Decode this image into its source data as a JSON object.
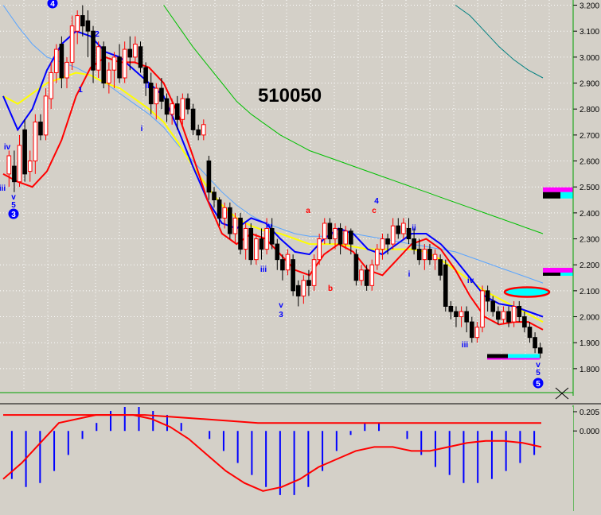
{
  "title": "510050",
  "colors": {
    "background": "#d4d0c8",
    "grid": "#ffffff",
    "candle_up": "#ff0000",
    "candle_down": "#000000",
    "ma_short": "#ff0000",
    "band_upper": "#0000ff",
    "ma_mid": "#ffff00",
    "band_outer": "#5aa5ff",
    "ma_long": "#00c000",
    "ma_longest": "#008080",
    "wave_label_blue": "#0000ff",
    "wave_label_red": "#ff0000",
    "axis_line": "#00a000"
  },
  "cursor_icon": "crosshair-icon",
  "chart_data": [
    {
      "type": "candlestick",
      "title": "510050",
      "ylim": [
        1.72,
        3.22
      ],
      "yticks": [
        "3.200",
        "3.100",
        "3.000",
        "2.900",
        "2.800",
        "2.700",
        "2.600",
        "2.500",
        "2.400",
        "2.300",
        "2.200",
        "2.100",
        "2.000",
        "1.900",
        "1.800"
      ],
      "grid": true,
      "candles": [
        [
          2.55,
          2.62,
          2.5,
          2.64
        ],
        [
          2.58,
          2.52,
          2.48,
          2.64
        ],
        [
          2.52,
          2.66,
          2.5,
          2.7
        ],
        [
          2.72,
          2.55,
          2.52,
          2.76
        ],
        [
          2.56,
          2.6,
          2.52,
          2.64
        ],
        [
          2.6,
          2.75,
          2.55,
          2.78
        ],
        [
          2.75,
          2.7,
          2.68,
          2.78
        ],
        [
          2.7,
          2.85,
          2.68,
          2.88
        ],
        [
          2.84,
          2.94,
          2.8,
          2.98
        ],
        [
          2.94,
          3.03,
          2.9,
          3.05
        ],
        [
          3.05,
          2.92,
          2.88,
          3.08
        ],
        [
          2.92,
          2.98,
          2.88,
          3.0
        ],
        [
          2.98,
          3.12,
          2.95,
          3.16
        ],
        [
          3.1,
          3.16,
          3.05,
          3.18
        ],
        [
          3.16,
          3.12,
          3.08,
          3.2
        ],
        [
          3.14,
          3.1,
          3.0,
          3.18
        ],
        [
          3.1,
          2.95,
          2.9,
          3.12
        ],
        [
          2.95,
          3.04,
          2.92,
          3.06
        ],
        [
          3.04,
          2.9,
          2.88,
          3.06
        ],
        [
          2.9,
          2.95,
          2.86,
          2.98
        ],
        [
          2.95,
          3.0,
          2.88,
          3.02
        ],
        [
          3.0,
          2.92,
          2.9,
          3.05
        ],
        [
          2.92,
          3.03,
          2.9,
          3.06
        ],
        [
          3.03,
          3.0,
          2.95,
          3.08
        ],
        [
          3.0,
          3.05,
          2.98,
          3.08
        ],
        [
          3.04,
          2.96,
          2.94,
          3.06
        ],
        [
          2.96,
          2.9,
          2.85,
          2.98
        ],
        [
          2.9,
          2.82,
          2.78,
          2.94
        ],
        [
          2.82,
          2.88,
          2.76,
          2.9
        ],
        [
          2.88,
          2.83,
          2.8,
          2.92
        ],
        [
          2.84,
          2.78,
          2.75,
          2.86
        ],
        [
          2.78,
          2.82,
          2.74,
          2.84
        ],
        [
          2.82,
          2.76,
          2.72,
          2.85
        ],
        [
          2.76,
          2.84,
          2.74,
          2.86
        ],
        [
          2.84,
          2.8,
          2.78,
          2.86
        ],
        [
          2.8,
          2.72,
          2.7,
          2.82
        ],
        [
          2.72,
          2.7,
          2.68,
          2.74
        ],
        [
          2.7,
          2.74,
          2.68,
          2.76
        ],
        [
          2.6,
          2.48,
          2.45,
          2.62
        ],
        [
          2.48,
          2.45,
          2.42,
          2.5
        ],
        [
          2.45,
          2.38,
          2.35,
          2.46
        ],
        [
          2.38,
          2.42,
          2.34,
          2.44
        ],
        [
          2.42,
          2.32,
          2.3,
          2.44
        ],
        [
          2.32,
          2.38,
          2.28,
          2.4
        ],
        [
          2.38,
          2.26,
          2.24,
          2.4
        ],
        [
          2.26,
          2.34,
          2.22,
          2.36
        ],
        [
          2.34,
          2.22,
          2.2,
          2.36
        ],
        [
          2.22,
          2.3,
          2.2,
          2.32
        ],
        [
          2.3,
          2.26,
          2.22,
          2.34
        ],
        [
          2.26,
          2.34,
          2.24,
          2.38
        ],
        [
          2.34,
          2.28,
          2.26,
          2.38
        ],
        [
          2.28,
          2.22,
          2.18,
          2.3
        ],
        [
          2.22,
          2.18,
          2.14,
          2.24
        ],
        [
          2.18,
          2.24,
          2.16,
          2.26
        ],
        [
          2.22,
          2.1,
          2.08,
          2.24
        ],
        [
          2.12,
          2.08,
          2.04,
          2.14
        ],
        [
          2.08,
          2.14,
          2.05,
          2.16
        ],
        [
          2.14,
          2.12,
          2.08,
          2.18
        ],
        [
          2.12,
          2.22,
          2.1,
          2.24
        ],
        [
          2.22,
          2.3,
          2.2,
          2.32
        ],
        [
          2.3,
          2.36,
          2.28,
          2.38
        ],
        [
          2.36,
          2.3,
          2.28,
          2.38
        ],
        [
          2.3,
          2.34,
          2.26,
          2.36
        ],
        [
          2.34,
          2.28,
          2.24,
          2.36
        ],
        [
          2.28,
          2.33,
          2.26,
          2.35
        ],
        [
          2.33,
          2.28,
          2.24,
          2.34
        ],
        [
          2.24,
          2.14,
          2.12,
          2.26
        ],
        [
          2.14,
          2.18,
          2.12,
          2.2
        ],
        [
          2.18,
          2.12,
          2.1,
          2.2
        ],
        [
          2.12,
          2.2,
          2.1,
          2.22
        ],
        [
          2.2,
          2.26,
          2.18,
          2.28
        ],
        [
          2.26,
          2.3,
          2.22,
          2.32
        ],
        [
          2.3,
          2.28,
          2.24,
          2.32
        ],
        [
          2.28,
          2.35,
          2.26,
          2.38
        ],
        [
          2.35,
          2.32,
          2.3,
          2.38
        ],
        [
          2.32,
          2.36,
          2.3,
          2.38
        ],
        [
          2.34,
          2.3,
          2.28,
          2.38
        ],
        [
          2.3,
          2.26,
          2.24,
          2.34
        ],
        [
          2.26,
          2.22,
          2.2,
          2.3
        ],
        [
          2.22,
          2.26,
          2.18,
          2.28
        ],
        [
          2.26,
          2.22,
          2.2,
          2.28
        ],
        [
          2.22,
          2.24,
          2.18,
          2.26
        ],
        [
          2.22,
          2.16,
          2.14,
          2.24
        ],
        [
          2.2,
          2.04,
          2.02,
          2.22
        ],
        [
          2.04,
          2.02,
          1.99,
          2.06
        ],
        [
          2.02,
          2.0,
          1.96,
          2.04
        ],
        [
          2.0,
          2.02,
          1.96,
          2.04
        ],
        [
          2.02,
          1.98,
          1.94,
          2.04
        ],
        [
          1.98,
          1.92,
          1.9,
          2.0
        ],
        [
          1.92,
          1.96,
          1.9,
          1.98
        ],
        [
          1.96,
          2.1,
          1.94,
          2.12
        ],
        [
          2.1,
          2.06,
          2.02,
          2.12
        ],
        [
          2.06,
          2.02,
          2.0,
          2.08
        ],
        [
          2.02,
          1.99,
          1.97,
          2.04
        ],
        [
          1.99,
          2.02,
          1.97,
          2.04
        ],
        [
          2.02,
          1.98,
          1.96,
          2.04
        ],
        [
          1.98,
          2.04,
          1.96,
          2.06
        ],
        [
          2.04,
          2.0,
          1.98,
          2.06
        ],
        [
          2.0,
          1.96,
          1.94,
          2.02
        ],
        [
          1.96,
          1.92,
          1.9,
          1.98
        ],
        [
          1.92,
          1.88,
          1.86,
          1.94
        ],
        [
          1.88,
          1.86,
          1.84,
          1.9
        ]
      ],
      "ma_short": [
        2.55,
        2.52,
        2.5,
        2.56,
        2.68,
        2.85,
        2.96,
        3.0,
        2.98,
        2.98,
        2.96,
        2.9,
        2.78,
        2.62,
        2.45,
        2.32,
        2.28,
        2.32,
        2.3,
        2.24,
        2.18,
        2.16,
        2.24,
        2.28,
        2.25,
        2.18,
        2.16,
        2.22,
        2.28,
        2.3,
        2.26,
        2.18,
        2.08,
        2.0,
        1.97,
        1.98,
        1.98,
        1.95
      ],
      "band_upper": [
        2.85,
        2.72,
        2.8,
        2.95,
        3.05,
        3.1,
        3.08,
        3.02,
        3.0,
        2.95,
        2.9,
        2.85,
        2.72,
        2.58,
        2.45,
        2.36,
        2.34,
        2.38,
        2.36,
        2.3,
        2.25,
        2.24,
        2.3,
        2.34,
        2.32,
        2.26,
        2.24,
        2.28,
        2.32,
        2.32,
        2.28,
        2.22,
        2.15,
        2.08,
        2.05,
        2.04,
        2.02,
        2.0
      ],
      "ma_mid": [
        2.85,
        2.82,
        2.86,
        2.9,
        2.92,
        2.94,
        2.93,
        2.9,
        2.88,
        2.84,
        2.8,
        2.75,
        2.67,
        2.58,
        2.5,
        2.43,
        2.38,
        2.35,
        2.33,
        2.32,
        2.3,
        2.28,
        2.28,
        2.28,
        2.27,
        2.26,
        2.26,
        2.26,
        2.26,
        2.25,
        2.22,
        2.18,
        2.14,
        2.1,
        2.07,
        2.04,
        2.01,
        1.98
      ],
      "band_outer": [
        3.2,
        3.12,
        3.05,
        3.0,
        2.98,
        2.96,
        2.93,
        2.9,
        2.86,
        2.82,
        2.78,
        2.73,
        2.66,
        2.6,
        2.54,
        2.48,
        2.43,
        2.39,
        2.36,
        2.34,
        2.32,
        2.31,
        2.31,
        2.32,
        2.32,
        2.31,
        2.3,
        2.29,
        2.28,
        2.27,
        2.26,
        2.25,
        2.23,
        2.21,
        2.19,
        2.17,
        2.15,
        2.13
      ],
      "ma_long": [
        null,
        null,
        null,
        null,
        null,
        null,
        null,
        null,
        null,
        null,
        null,
        3.2,
        3.12,
        3.04,
        2.97,
        2.9,
        2.83,
        2.78,
        2.74,
        2.7,
        2.67,
        2.64,
        2.62,
        2.6,
        2.58,
        2.56,
        2.54,
        2.52,
        2.5,
        2.48,
        2.46,
        2.44,
        2.42,
        2.4,
        2.38,
        2.36,
        2.34,
        2.32
      ],
      "ma_longest": [
        null,
        null,
        null,
        null,
        null,
        null,
        null,
        null,
        null,
        null,
        null,
        null,
        null,
        null,
        null,
        null,
        null,
        null,
        null,
        null,
        null,
        null,
        null,
        null,
        null,
        null,
        null,
        null,
        null,
        null,
        null,
        3.2,
        3.16,
        3.1,
        3.04,
        2.99,
        2.95,
        2.92
      ],
      "wave_labels": [
        {
          "text": "4",
          "color": "blue",
          "circled": true
        },
        {
          "text": "2",
          "color": "blue"
        },
        {
          "text": "1",
          "color": "blue"
        },
        {
          "text": "ii",
          "color": "blue"
        },
        {
          "text": "i",
          "color": "blue"
        },
        {
          "text": "iv",
          "color": "blue"
        },
        {
          "text": "iii",
          "color": "blue"
        },
        {
          "text": "v",
          "color": "blue"
        },
        {
          "text": "5",
          "color": "blue"
        },
        {
          "text": "3",
          "color": "blue",
          "circled": true
        },
        {
          "text": "iv",
          "color": "blue"
        },
        {
          "text": "iii",
          "color": "blue"
        },
        {
          "text": "v",
          "color": "blue"
        },
        {
          "text": "3",
          "color": "blue"
        },
        {
          "text": "a",
          "color": "red"
        },
        {
          "text": "b",
          "color": "red"
        },
        {
          "text": "4",
          "color": "blue"
        },
        {
          "text": "c",
          "color": "red"
        },
        {
          "text": "ii",
          "color": "blue"
        },
        {
          "text": "i",
          "color": "blue"
        },
        {
          "text": "iv",
          "color": "blue"
        },
        {
          "text": "iii",
          "color": "blue"
        },
        {
          "text": "v",
          "color": "blue"
        },
        {
          "text": "5",
          "color": "blue"
        },
        {
          "text": "5",
          "color": "blue",
          "circled": true
        }
      ],
      "price_zone_markers": [
        2.48,
        2.17,
        1.85
      ],
      "target_ellipse_level": 2.095
    },
    {
      "type": "bar",
      "title": "",
      "ylim": [
        -0.2,
        0.06
      ],
      "yticks": [
        "0.205",
        "0.000"
      ],
      "grid": false,
      "macd_hist": [
        -0.12,
        -0.14,
        -0.13,
        -0.1,
        -0.06,
        -0.02,
        0.02,
        0.05,
        0.06,
        0.06,
        0.05,
        0.04,
        0.02,
        0.0,
        -0.02,
        -0.05,
        -0.08,
        -0.11,
        -0.14,
        -0.16,
        -0.16,
        -0.14,
        -0.1,
        -0.05,
        -0.01,
        0.02,
        0.02,
        0.0,
        -0.02,
        -0.06,
        -0.09,
        -0.11,
        -0.13,
        -0.13,
        -0.12,
        -0.1,
        -0.08,
        -0.06
      ],
      "macd_line": [
        -0.12,
        -0.08,
        -0.03,
        0.02,
        0.03,
        0.04,
        0.04,
        0.04,
        0.03,
        0.01,
        -0.02,
        -0.06,
        -0.1,
        -0.13,
        -0.15,
        -0.14,
        -0.12,
        -0.09,
        -0.07,
        -0.05,
        -0.04,
        -0.04,
        -0.05,
        -0.05,
        -0.04,
        -0.03,
        -0.025,
        -0.025,
        -0.03,
        -0.04
      ],
      "signal_line": [
        0.04,
        0.04,
        0.04,
        0.04,
        0.04,
        0.04,
        0.035,
        0.03,
        0.025,
        0.02,
        0.02,
        0.02,
        0.02,
        0.02,
        0.02,
        0.02,
        0.02,
        0.02,
        0.02,
        0.02
      ]
    }
  ]
}
